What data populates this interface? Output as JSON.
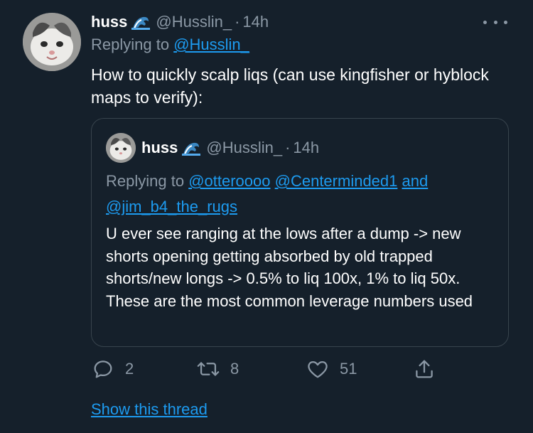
{
  "tweet": {
    "author_name": "huss",
    "author_emoji_icon": "wave-emoji",
    "author_handle": "@Husslin_",
    "separator": "·",
    "time": "14h",
    "replying_prefix": "Replying to",
    "replying_to": "@Husslin_",
    "text": "How to quickly scalp liqs (can use kingfisher or hyblock maps to verify):"
  },
  "quote": {
    "author_name": "huss",
    "author_handle": "@Husslin_",
    "separator": "·",
    "time": "14h",
    "replying_prefix": "Replying to",
    "mentions": [
      "@otteroooo",
      "@Centerminded1",
      "and",
      "@jim_b4_the_rugs"
    ],
    "text": "U ever see ranging at the lows after a dump -> new shorts opening getting absorbed by old trapped shorts/new longs -> 0.5% to liq 100x, 1% to liq 50x. These are the most common leverage numbers used"
  },
  "actions": {
    "replies": "2",
    "retweets": "8",
    "likes": "51"
  },
  "show_thread": "Show this thread",
  "colors": {
    "background": "#15202b",
    "secondary_text": "#8b98a5",
    "link": "#1d9bf0",
    "border": "#38444d"
  }
}
